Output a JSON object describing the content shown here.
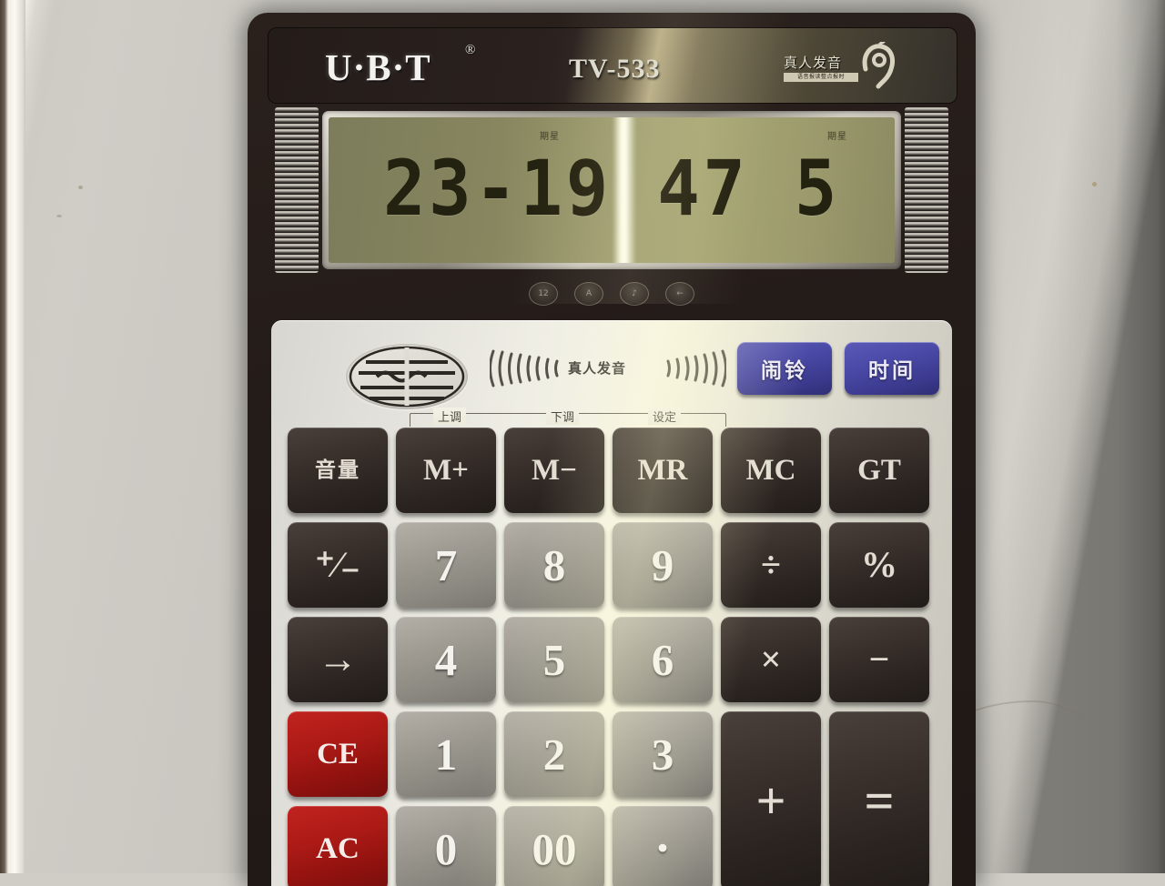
{
  "device": {
    "brand": "U·B·T",
    "brand_registered_mark": "®",
    "model": "TV-533",
    "voice_logo_text": "真人发音",
    "voice_logo_sub": "语音报读整点报时",
    "wave_label": "真人发音"
  },
  "display": {
    "value": "23-19 47 5",
    "segments": [
      "23",
      "-",
      "19",
      "47",
      "5"
    ],
    "mini_left": "期星",
    "mini_right": "期星",
    "indicators": [
      "12",
      "A",
      "♪",
      "←"
    ]
  },
  "hints": {
    "up": "上调",
    "down": "下调",
    "set": "设定"
  },
  "blue_buttons": [
    {
      "label": "闹铃",
      "name": "alarm-button"
    },
    {
      "label": "时间",
      "name": "time-button"
    }
  ],
  "keys": [
    {
      "label": "音量",
      "name": "volume-key",
      "style": "dark",
      "size": "cjk"
    },
    {
      "label": "M+",
      "name": "memory-plus-key",
      "style": "dark",
      "size": "small"
    },
    {
      "label": "M−",
      "name": "memory-minus-key",
      "style": "dark",
      "size": "small"
    },
    {
      "label": "MR",
      "name": "memory-recall-key",
      "style": "dark",
      "size": "small"
    },
    {
      "label": "MC",
      "name": "memory-clear-key",
      "style": "dark",
      "size": "small"
    },
    {
      "label": "GT",
      "name": "grand-total-key",
      "style": "dark",
      "size": "small"
    },
    {
      "label": "⁺⁄₋",
      "name": "sign-change-key",
      "style": "dark",
      "size": "plusminus"
    },
    {
      "label": "7",
      "name": "digit-7-key",
      "style": "light",
      "size": "num"
    },
    {
      "label": "8",
      "name": "digit-8-key",
      "style": "light",
      "size": "num"
    },
    {
      "label": "9",
      "name": "digit-9-key",
      "style": "light",
      "size": "num"
    },
    {
      "label": "÷",
      "name": "divide-key",
      "style": "dark",
      "size": "normal"
    },
    {
      "label": "%",
      "name": "percent-key",
      "style": "dark",
      "size": "normal"
    },
    {
      "label": "→",
      "name": "backspace-key",
      "style": "dark",
      "size": "arrow"
    },
    {
      "label": "4",
      "name": "digit-4-key",
      "style": "light",
      "size": "num"
    },
    {
      "label": "5",
      "name": "digit-5-key",
      "style": "light",
      "size": "num"
    },
    {
      "label": "6",
      "name": "digit-6-key",
      "style": "light",
      "size": "num"
    },
    {
      "label": "×",
      "name": "multiply-key",
      "style": "dark",
      "size": "normal"
    },
    {
      "label": "−",
      "name": "minus-key",
      "style": "dark",
      "size": "normal"
    },
    {
      "label": "CE",
      "name": "clear-entry-key",
      "style": "red",
      "size": "small"
    },
    {
      "label": "1",
      "name": "digit-1-key",
      "style": "light",
      "size": "num"
    },
    {
      "label": "2",
      "name": "digit-2-key",
      "style": "light",
      "size": "num"
    },
    {
      "label": "3",
      "name": "digit-3-key",
      "style": "light",
      "size": "num"
    },
    {
      "label": "+",
      "name": "plus-key",
      "style": "dark",
      "size": "tall"
    },
    {
      "label": "=",
      "name": "equals-key",
      "style": "dark",
      "size": "tall"
    },
    {
      "label": "AC",
      "name": "all-clear-key",
      "style": "red",
      "size": "small"
    },
    {
      "label": "0",
      "name": "digit-0-key",
      "style": "light",
      "size": "num"
    },
    {
      "label": "00",
      "name": "double-zero-key",
      "style": "light",
      "size": "num"
    },
    {
      "label": "·",
      "name": "decimal-point-key",
      "style": "light",
      "size": "dot"
    }
  ],
  "colors": {
    "body": "#241c19",
    "keypad": "#eceadd",
    "lcd": "#9b9a6c",
    "blue_button": "#4a49a6",
    "red_button": "#ab1a16",
    "dark_key": "#2b2421",
    "light_key": "#908d85"
  }
}
